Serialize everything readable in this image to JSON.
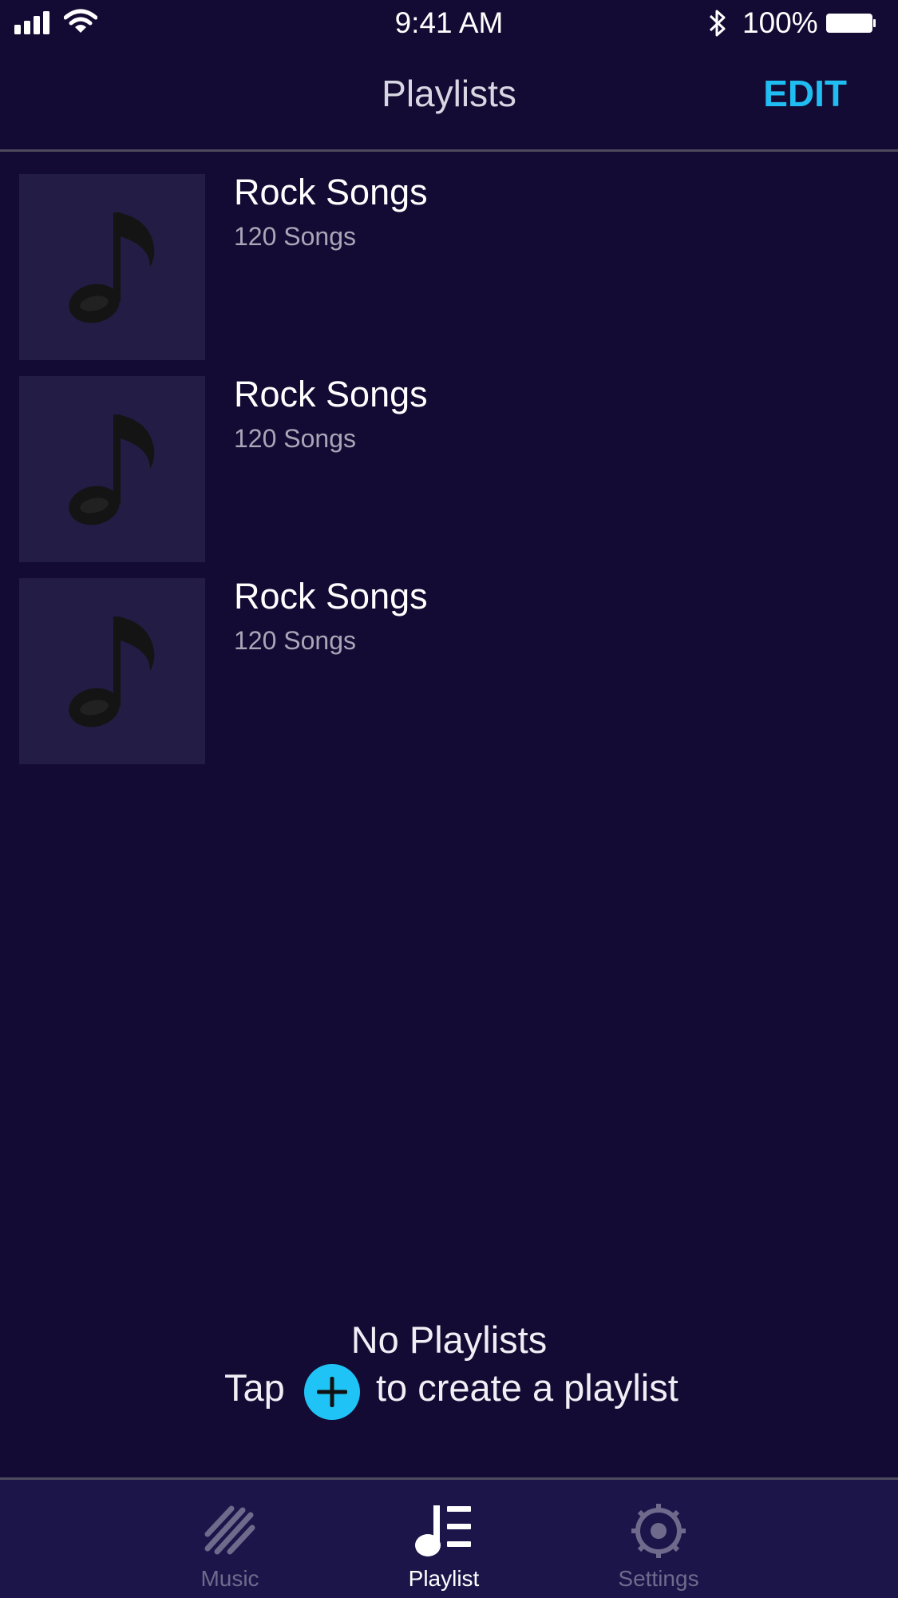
{
  "status_bar": {
    "time": "9:41 AM",
    "battery": "100%"
  },
  "nav": {
    "title": "Playlists",
    "edit_label": "EDIT"
  },
  "playlists": [
    {
      "title": "Rock Songs",
      "count": "120 Songs",
      "icon": "music-note-icon"
    },
    {
      "title": "Rock Songs",
      "count": "120 Songs",
      "icon": "music-note-icon"
    },
    {
      "title": "Rock Songs",
      "count": "120 Songs",
      "icon": "music-note-icon"
    }
  ],
  "empty_state": {
    "title": "No Playlists",
    "tap_label": "Tap",
    "action_text": "to create a playlist",
    "icon": "add-circle-icon"
  },
  "tabs": [
    {
      "label": "Music",
      "icon": "music-stripes-icon",
      "active": false
    },
    {
      "label": "Playlist",
      "icon": "playlist-icon",
      "active": true
    },
    {
      "label": "Settings",
      "icon": "gear-icon",
      "active": false
    }
  ],
  "colors": {
    "background": "#130b33",
    "accent": "#20bdf2",
    "thumbnail": "#231c45",
    "tab_bar": "#1c154a",
    "inactive_tab": "#6f6a8c"
  }
}
